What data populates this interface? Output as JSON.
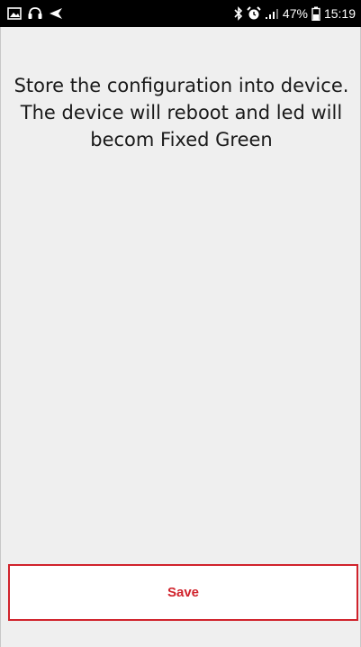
{
  "status_bar": {
    "left_icons": [
      "image-notification-icon",
      "headset-notification-icon",
      "send-notification-icon"
    ],
    "right_icons": [
      "bluetooth-icon",
      "alarm-icon",
      "signal-icon",
      "battery-icon"
    ],
    "battery_percent": "47%",
    "time": "15:19"
  },
  "main": {
    "message_lines": [
      "Store the configuration into device.",
      "The device will reboot and led will",
      "becom Fixed Green"
    ]
  },
  "footer": {
    "save_label": "Save"
  },
  "colors": {
    "accent": "#d0232c",
    "background": "#efefef",
    "status_bar": "#000000"
  }
}
